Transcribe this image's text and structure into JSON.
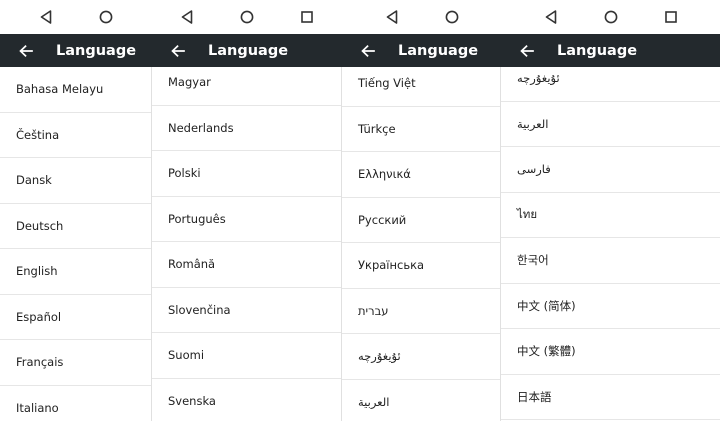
{
  "screens": [
    {
      "title": "Language",
      "items": [
        "Bahasa Melayu",
        "Čeština",
        "Dansk",
        "Deutsch",
        "English",
        "Español",
        "Français",
        "Italiano"
      ]
    },
    {
      "title": "Language",
      "items": [
        "Magyar",
        "Nederlands",
        "Polski",
        "Português",
        "Română",
        "Slovenčina",
        "Suomi",
        "Svenska"
      ]
    },
    {
      "title": "Language",
      "items": [
        "Tiếng Việt",
        "Türkçe",
        "Ελληνικά",
        "Русский",
        "Українська",
        "עברית",
        "ئۇيغۇرچە",
        "العربية"
      ]
    },
    {
      "title": "Language",
      "items": [
        "ئۇيغۇرچە",
        "العربية",
        "فارسی",
        "ไทย",
        "한국어",
        "中文 (简体)",
        "中文 (繁體)",
        "日本語"
      ]
    }
  ],
  "icons": {
    "back": "back-arrow-icon",
    "nav_back": "triangle-back-icon",
    "nav_home": "circle-home-icon",
    "nav_recents": "square-recents-icon"
  },
  "colors": {
    "appbar": "#23292d",
    "divider": "#e6e6e6"
  }
}
